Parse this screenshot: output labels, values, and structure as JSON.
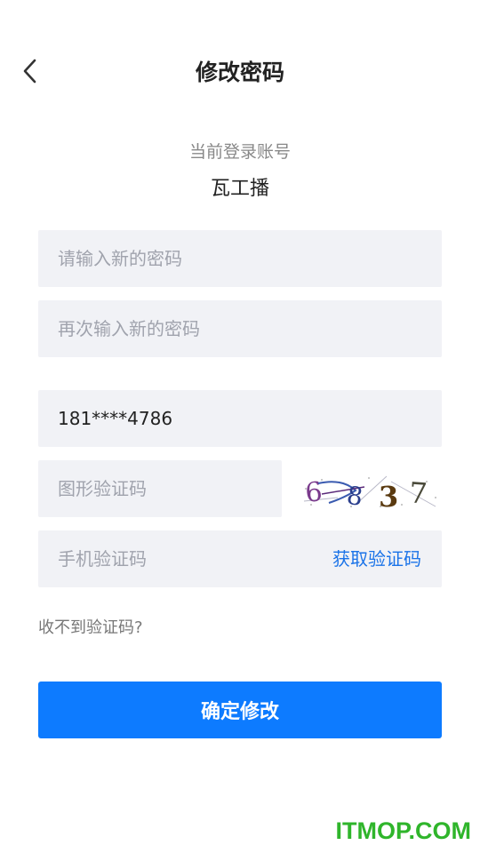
{
  "header": {
    "title": "修改密码"
  },
  "account": {
    "label": "当前登录账号",
    "name": "瓦工播"
  },
  "form": {
    "new_password_placeholder": "请输入新的密码",
    "confirm_password_placeholder": "再次输入新的密码",
    "phone_value": "181****4786",
    "captcha_placeholder": "图形验证码",
    "captcha_text": "6837",
    "sms_code_placeholder": "手机验证码",
    "get_code_label": "获取验证码",
    "help_label": "收不到验证码?",
    "submit_label": "确定修改"
  },
  "watermark": {
    "text": "ITMOP.COM"
  },
  "colors": {
    "accent": "#0d7bff",
    "link": "#1a73e8",
    "field_bg": "#f1f2f6",
    "watermark": "#2fb52b"
  },
  "icons": {
    "back": "chevron-left-icon"
  }
}
